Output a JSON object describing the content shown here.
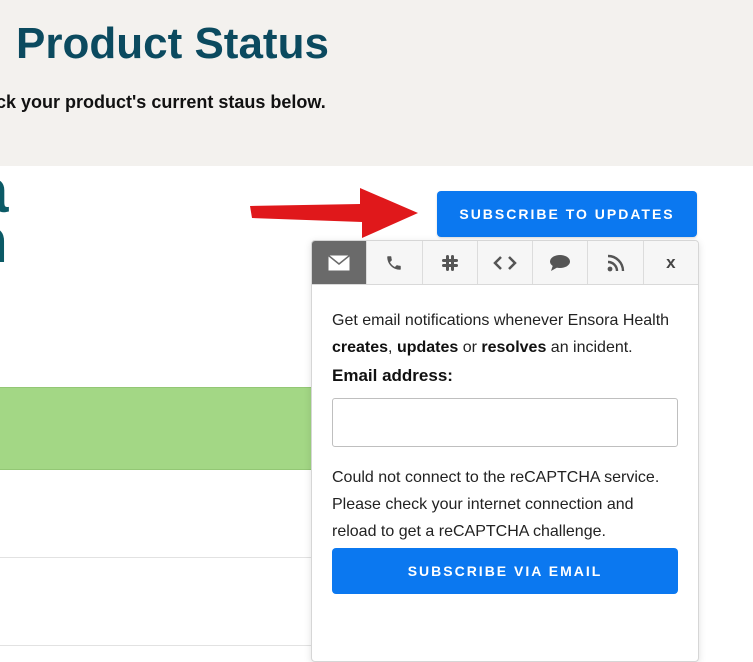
{
  "page": {
    "title": "Product Status",
    "subtitle": "eck your product's current staus below.",
    "logo_fragment": [
      "a",
      "n"
    ]
  },
  "header": {
    "subscribe_button": "SUBSCRIBE TO UPDATES"
  },
  "colors": {
    "accent": "#0b78f0",
    "title": "#0b4a5f",
    "status_operational": "#a3d785",
    "arrow": "#e0181b"
  },
  "popup": {
    "tabs": [
      {
        "icon": "envelope-icon",
        "active": true
      },
      {
        "icon": "phone-icon",
        "active": false
      },
      {
        "icon": "slack-icon",
        "active": false
      },
      {
        "icon": "code-icon",
        "active": false
      },
      {
        "icon": "chat-bubble-icon",
        "active": false
      },
      {
        "icon": "rss-icon",
        "active": false
      }
    ],
    "close_label": "x",
    "description": {
      "prefix": "Get email notifications whenever Ensora Health ",
      "creates": "creates",
      "sep1": ", ",
      "updates": "updates",
      "sep2": " or ",
      "resolves": "resolves",
      "suffix": " an incident."
    },
    "email_label": "Email address:",
    "email_value": "",
    "email_placeholder": "",
    "recaptcha_message": "Could not connect to the reCAPTCHA service. Please check your internet connection and reload to get a reCAPTCHA challenge.",
    "submit_label": "SUBSCRIBE VIA EMAIL"
  }
}
